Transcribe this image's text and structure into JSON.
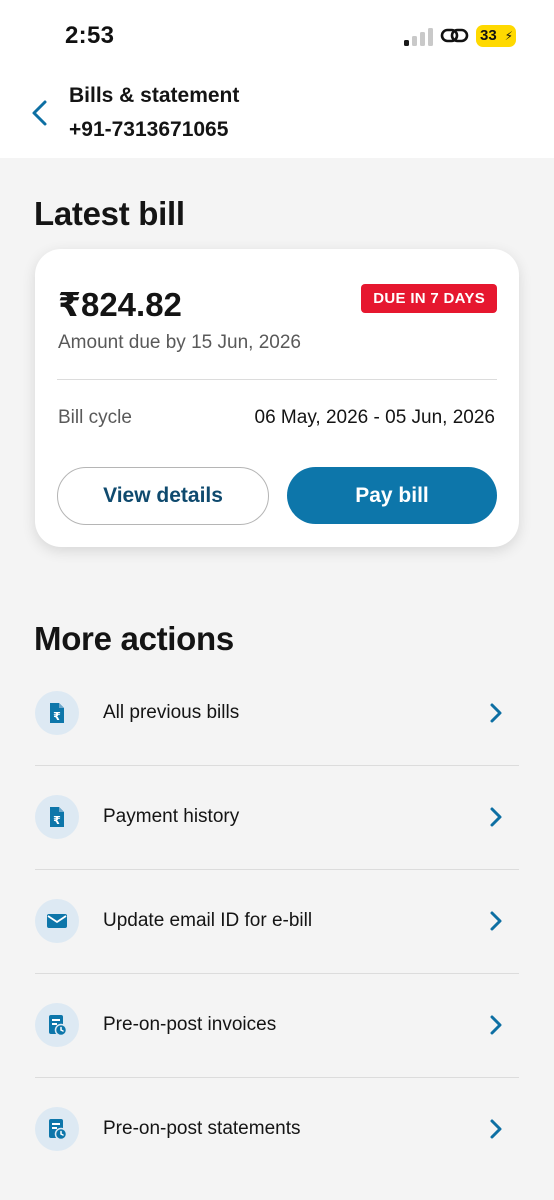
{
  "status_bar": {
    "time": "2:53",
    "battery": "33"
  },
  "header": {
    "title": "Bills & statement",
    "phone": "+91-7313671065"
  },
  "latest_bill": {
    "section_title": "Latest bill",
    "amount": "₹824.82",
    "due_badge": "DUE IN 7 DAYS",
    "due_by": "Amount due by 15 Jun, 2026",
    "cycle_label": "Bill cycle",
    "cycle_value": "06 May, 2026 - 05 Jun, 2026",
    "view_details_label": "View details",
    "pay_bill_label": "Pay bill"
  },
  "more_actions": {
    "section_title": "More actions",
    "items": [
      {
        "label": "All previous bills",
        "icon": "rupee-document-icon"
      },
      {
        "label": "Payment history",
        "icon": "rupee-document-icon"
      },
      {
        "label": "Update email ID for e-bill",
        "icon": "envelope-icon"
      },
      {
        "label": "Pre-on-post invoices",
        "icon": "document-clock-icon"
      },
      {
        "label": "Pre-on-post statements",
        "icon": "document-clock-icon"
      }
    ]
  },
  "colors": {
    "accent": "#0d76aa",
    "accent_dark_text": "#0f4a6e",
    "due_badge": "#e6172f",
    "icon_bg": "#dde9f3",
    "page_bg": "#f4f4f4",
    "battery": "#ffd900"
  }
}
